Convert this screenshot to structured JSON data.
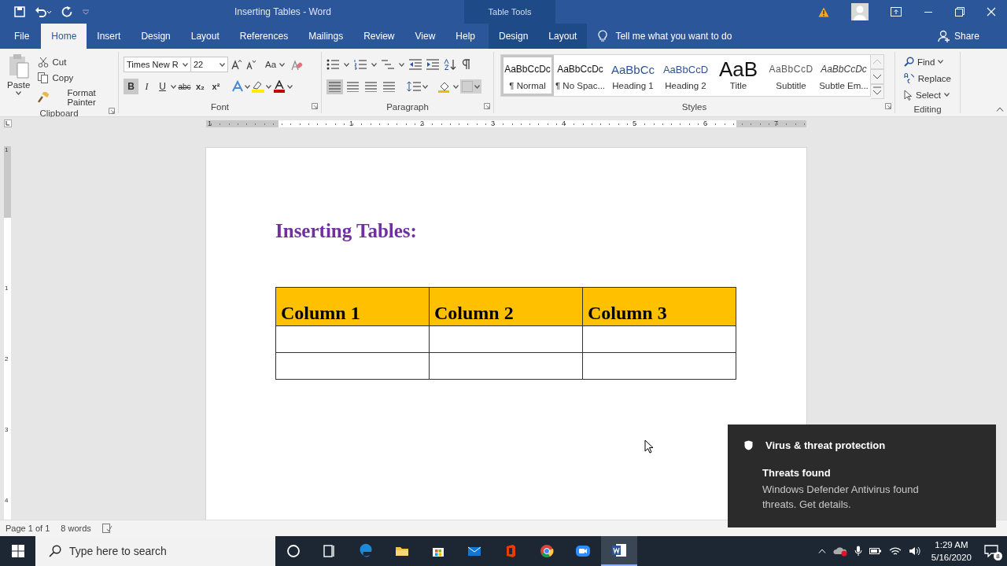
{
  "title_bar": {
    "title": "Inserting Tables  -  Word",
    "context_label": "Table Tools"
  },
  "tabs": [
    {
      "label": "File",
      "selected": false,
      "kind": "file"
    },
    {
      "label": "Home",
      "selected": true,
      "kind": "main"
    },
    {
      "label": "Insert",
      "selected": false,
      "kind": "main"
    },
    {
      "label": "Design",
      "selected": false,
      "kind": "main"
    },
    {
      "label": "Layout",
      "selected": false,
      "kind": "main"
    },
    {
      "label": "References",
      "selected": false,
      "kind": "main"
    },
    {
      "label": "Mailings",
      "selected": false,
      "kind": "main"
    },
    {
      "label": "Review",
      "selected": false,
      "kind": "main"
    },
    {
      "label": "View",
      "selected": false,
      "kind": "main"
    },
    {
      "label": "Help",
      "selected": false,
      "kind": "main"
    },
    {
      "label": "Design",
      "selected": false,
      "kind": "context"
    },
    {
      "label": "Layout",
      "selected": false,
      "kind": "context"
    }
  ],
  "tell_me": {
    "placeholder": "Tell me what you want to do"
  },
  "share": "Share",
  "clipboard": {
    "group": "Clipboard",
    "paste": "Paste",
    "items": [
      {
        "label": "Cut",
        "kind": "cut"
      },
      {
        "label": "Copy",
        "kind": "copy"
      },
      {
        "label": "Format Painter",
        "kind": "painter"
      }
    ]
  },
  "font": {
    "group": "Font",
    "name": "Times New R",
    "size": "22",
    "change_case": "Aa",
    "format_buttons": [
      {
        "label": "B",
        "kind": "bold",
        "selected": true
      },
      {
        "label": "I",
        "kind": "italic",
        "selected": false
      },
      {
        "label": "U",
        "kind": "underline",
        "selected": false
      },
      {
        "label": "abc",
        "kind": "strike",
        "selected": false
      },
      {
        "label": "x₂",
        "kind": "sub",
        "selected": false
      },
      {
        "label": "x²",
        "kind": "sup",
        "selected": false
      }
    ]
  },
  "paragraph": {
    "group": "Paragraph",
    "alignments": [
      {
        "selected": true
      },
      {
        "selected": false
      },
      {
        "selected": false
      },
      {
        "selected": false
      }
    ]
  },
  "styles": {
    "group": "Styles",
    "items": [
      {
        "preview": "AaBbCcDc",
        "name": "¶ Normal",
        "selected": true,
        "kind": "normal"
      },
      {
        "preview": "AaBbCcDc",
        "name": "¶ No Spac...",
        "selected": false,
        "kind": "normal"
      },
      {
        "preview": "AaBbCc",
        "name": "Heading 1",
        "selected": false,
        "kind": "heading1"
      },
      {
        "preview": "AaBbCcD",
        "name": "Heading 2",
        "selected": false,
        "kind": "heading2"
      },
      {
        "preview": "AaB",
        "name": "Title",
        "selected": false,
        "kind": "title"
      },
      {
        "preview": "AaBbCcD",
        "name": "Subtitle",
        "selected": false,
        "kind": "subtitle"
      },
      {
        "preview": "AaBbCcDc",
        "name": "Subtle Em...",
        "selected": false,
        "kind": "emphasis"
      }
    ]
  },
  "editing": {
    "group": "Editing",
    "items": [
      {
        "label": "Find",
        "kind": "find"
      },
      {
        "label": "Replace",
        "kind": "replace"
      },
      {
        "label": "Select",
        "kind": "select"
      }
    ]
  },
  "ruler": {
    "labels": [
      "1",
      "1",
      "2",
      "3",
      "4",
      "5",
      "6",
      "7"
    ]
  },
  "vertical_ruler": {
    "labels": [
      "1",
      "1",
      "2",
      "3",
      "4"
    ]
  },
  "document": {
    "heading": "Inserting Tables:",
    "table": {
      "columns": [
        "Column 1",
        "Column 2",
        "Column 3"
      ],
      "rows": [
        {
          "kind": "empty"
        },
        {
          "kind": "empty"
        }
      ]
    }
  },
  "status_bar": {
    "page": "Page 1 of 1",
    "words": "8 words"
  },
  "taskbar": {
    "search": {
      "placeholder": "Type here to search"
    },
    "time": "1:29 AM",
    "date": "5/16/2020",
    "notification_count": "8"
  },
  "toast": {
    "title": "Virus & threat protection",
    "heading": "Threats found",
    "body": "Windows Defender Antivirus found threats. Get details."
  }
}
